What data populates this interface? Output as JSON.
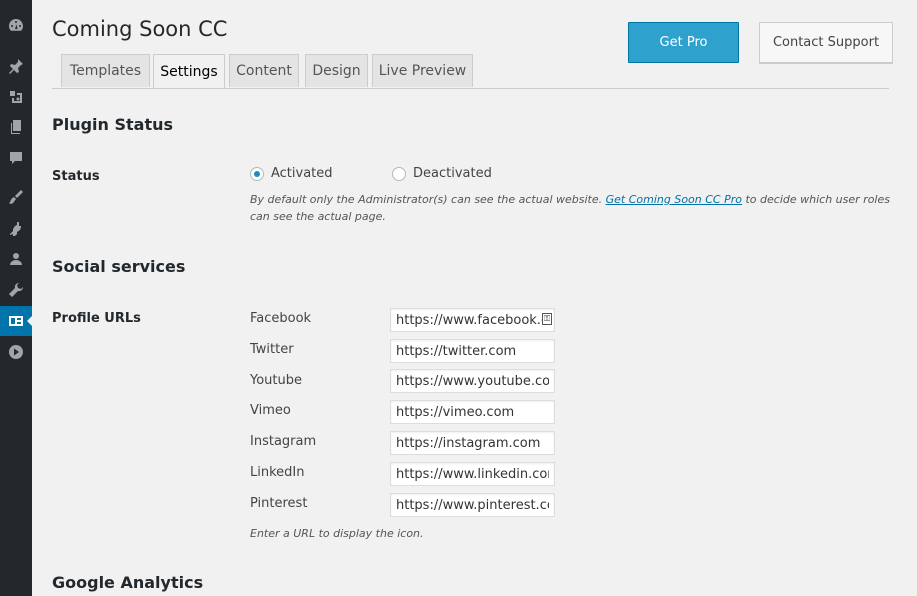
{
  "sidebar": {
    "items": [
      {
        "icon": "dashboard-icon"
      },
      {
        "icon": "pin-icon"
      },
      {
        "icon": "media-icon"
      },
      {
        "icon": "pages-icon"
      },
      {
        "icon": "comments-icon"
      },
      {
        "icon": "appearance-icon"
      },
      {
        "icon": "plugins-icon"
      },
      {
        "icon": "users-icon"
      },
      {
        "icon": "tools-icon"
      },
      {
        "icon": "coming-soon-icon",
        "active": true
      },
      {
        "icon": "play-icon"
      }
    ]
  },
  "header": {
    "title": "Coming Soon CC",
    "get_pro": "Get Pro",
    "contact_support": "Contact Support"
  },
  "tabs": [
    {
      "label": "Templates"
    },
    {
      "label": "Settings",
      "active": true
    },
    {
      "label": "Content"
    },
    {
      "label": "Design"
    },
    {
      "label": "Live Preview"
    }
  ],
  "plugin_status": {
    "heading": "Plugin Status",
    "row_label": "Status",
    "options": [
      {
        "label": "Activated",
        "selected": true
      },
      {
        "label": "Deactivated",
        "selected": false
      }
    ],
    "desc_before": "By default only the Administrator(s) can see the actual website. ",
    "desc_link": "Get Coming Soon CC Pro",
    "desc_after": " to decide which user roles can see the actual page."
  },
  "social": {
    "heading": "Social services",
    "row_label": "Profile URLs",
    "profiles": [
      {
        "label": "Facebook",
        "value": "https://www.facebook.com"
      },
      {
        "label": "Twitter",
        "value": "https://twitter.com"
      },
      {
        "label": "Youtube",
        "value": "https://www.youtube.com"
      },
      {
        "label": "Vimeo",
        "value": "https://vimeo.com"
      },
      {
        "label": "Instagram",
        "value": "https://instagram.com"
      },
      {
        "label": "LinkedIn",
        "value": "https://www.linkedin.com/"
      },
      {
        "label": "Pinterest",
        "value": "https://www.pinterest.com"
      }
    ],
    "hint": "Enter a URL to display the icon."
  },
  "analytics": {
    "heading": "Google Analytics"
  },
  "colors": {
    "sidebar_bg": "#23282d",
    "accent": "#0073aa",
    "primary_button": "#2ea2cc"
  }
}
